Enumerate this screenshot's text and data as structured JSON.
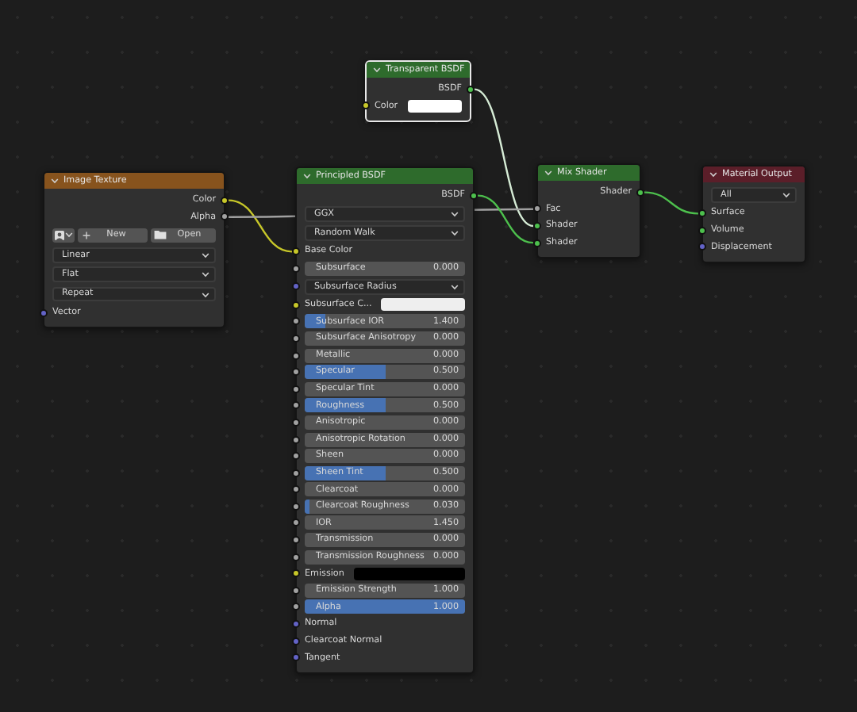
{
  "nodes": [
    {
      "title": "Transparent BSDF",
      "kind": "shader",
      "selected": true,
      "rows": [
        {
          "kind": "output",
          "label": "BSDF",
          "socket": {
            "color": "#4dc04d"
          }
        },
        {
          "kind": "color",
          "label": "Color",
          "color": "#ffffff",
          "socket": {
            "color": "#c7c729"
          }
        }
      ]
    },
    {
      "title": "Image Texture",
      "kind": "texture",
      "selected": false,
      "rows": [
        {
          "kind": "output",
          "label": "Color",
          "socket": {
            "color": "#c7c729"
          }
        },
        {
          "kind": "output",
          "label": "Alpha",
          "socket": {
            "color": "#a1a1a1"
          }
        },
        {
          "kind": "image_buttons",
          "new_label": "New",
          "open_label": "Open"
        },
        {
          "kind": "dropdown",
          "value": "Linear"
        },
        {
          "kind": "dropdown",
          "value": "Flat"
        },
        {
          "kind": "dropdown",
          "value": "Repeat"
        },
        {
          "kind": "input",
          "label": "Vector",
          "socket": {
            "color": "#6363c7"
          }
        }
      ]
    },
    {
      "title": "Principled BSDF",
      "kind": "shader",
      "selected": false,
      "rows": [
        {
          "kind": "output",
          "label": "BSDF",
          "socket": {
            "color": "#4dc04d"
          }
        },
        {
          "kind": "dropdown",
          "value": "GGX"
        },
        {
          "kind": "dropdown",
          "value": "Random Walk"
        },
        {
          "kind": "input",
          "label": "Base Color",
          "socket": {
            "color": "#c7c729"
          }
        },
        {
          "kind": "slider",
          "label": "Subsurface",
          "value": "0.000",
          "level": 0,
          "socket": {
            "color": "#a1a1a1"
          }
        },
        {
          "kind": "dropdown",
          "value": "Subsurface Radius",
          "socket": {
            "color": "#6363c7"
          }
        },
        {
          "kind": "color",
          "label": "Subsurface C...",
          "color": "#eeeeee",
          "socket": {
            "color": "#c7c729"
          }
        },
        {
          "kind": "slider",
          "label": "Subsurface IOR",
          "value": "1.400",
          "level": 0.13,
          "socket": {
            "color": "#a1a1a1"
          }
        },
        {
          "kind": "slider",
          "label": "Subsurface Anisotropy",
          "value": "0.000",
          "level": 0,
          "socket": {
            "color": "#a1a1a1"
          }
        },
        {
          "kind": "slider",
          "label": "Metallic",
          "value": "0.000",
          "level": 0,
          "socket": {
            "color": "#a1a1a1"
          }
        },
        {
          "kind": "slider",
          "label": "Specular",
          "value": "0.500",
          "level": 0.5,
          "socket": {
            "color": "#a1a1a1"
          }
        },
        {
          "kind": "slider",
          "label": "Specular Tint",
          "value": "0.000",
          "level": 0,
          "socket": {
            "color": "#a1a1a1"
          }
        },
        {
          "kind": "slider",
          "label": "Roughness",
          "value": "0.500",
          "level": 0.5,
          "socket": {
            "color": "#a1a1a1"
          }
        },
        {
          "kind": "slider",
          "label": "Anisotropic",
          "value": "0.000",
          "level": 0,
          "socket": {
            "color": "#a1a1a1"
          }
        },
        {
          "kind": "slider",
          "label": "Anisotropic Rotation",
          "value": "0.000",
          "level": 0,
          "socket": {
            "color": "#a1a1a1"
          }
        },
        {
          "kind": "slider",
          "label": "Sheen",
          "value": "0.000",
          "level": 0,
          "socket": {
            "color": "#a1a1a1"
          }
        },
        {
          "kind": "slider",
          "label": "Sheen Tint",
          "value": "0.500",
          "level": 0.5,
          "socket": {
            "color": "#a1a1a1"
          }
        },
        {
          "kind": "slider",
          "label": "Clearcoat",
          "value": "0.000",
          "level": 0,
          "socket": {
            "color": "#a1a1a1"
          }
        },
        {
          "kind": "slider",
          "label": "Clearcoat Roughness",
          "value": "0.030",
          "level": 0.03,
          "socket": {
            "color": "#a1a1a1"
          }
        },
        {
          "kind": "slider",
          "label": "IOR",
          "value": "1.450",
          "level": 0,
          "socket": {
            "color": "#a1a1a1"
          }
        },
        {
          "kind": "slider",
          "label": "Transmission",
          "value": "0.000",
          "level": 0,
          "socket": {
            "color": "#a1a1a1"
          }
        },
        {
          "kind": "slider",
          "label": "Transmission Roughness",
          "value": "0.000",
          "level": 0,
          "socket": {
            "color": "#a1a1a1"
          }
        },
        {
          "kind": "color",
          "label": "Emission",
          "color": "#000000",
          "socket": {
            "color": "#c7c729"
          }
        },
        {
          "kind": "slider",
          "label": "Emission Strength",
          "value": "1.000",
          "level": 0,
          "socket": {
            "color": "#a1a1a1"
          }
        },
        {
          "kind": "slider",
          "label": "Alpha",
          "value": "1.000",
          "level": 1,
          "socket": {
            "color": "#a1a1a1"
          }
        },
        {
          "kind": "input",
          "label": "Normal",
          "socket": {
            "color": "#6363c7"
          }
        },
        {
          "kind": "input",
          "label": "Clearcoat Normal",
          "socket": {
            "color": "#6363c7"
          }
        },
        {
          "kind": "input",
          "label": "Tangent",
          "socket": {
            "color": "#6363c7"
          }
        }
      ]
    },
    {
      "title": "Mix Shader",
      "kind": "shader",
      "selected": false,
      "rows": [
        {
          "kind": "output",
          "label": "Shader",
          "socket": {
            "color": "#4dc04d"
          }
        },
        {
          "kind": "input",
          "label": "Fac",
          "socket": {
            "color": "#a1a1a1"
          }
        },
        {
          "kind": "input",
          "label": "Shader",
          "socket": {
            "color": "#4dc04d"
          }
        },
        {
          "kind": "input",
          "label": "Shader",
          "socket": {
            "color": "#4dc04d"
          }
        }
      ]
    },
    {
      "title": "Material Output",
      "kind": "output",
      "selected": false,
      "rows": [
        {
          "kind": "dropdown",
          "value": "All"
        },
        {
          "kind": "input",
          "label": "Surface",
          "socket": {
            "color": "#4dc04d"
          }
        },
        {
          "kind": "input",
          "label": "Volume",
          "socket": {
            "color": "#4dc04d"
          }
        },
        {
          "kind": "input",
          "label": "Displacement",
          "socket": {
            "color": "#6363c7"
          }
        }
      ]
    }
  ]
}
